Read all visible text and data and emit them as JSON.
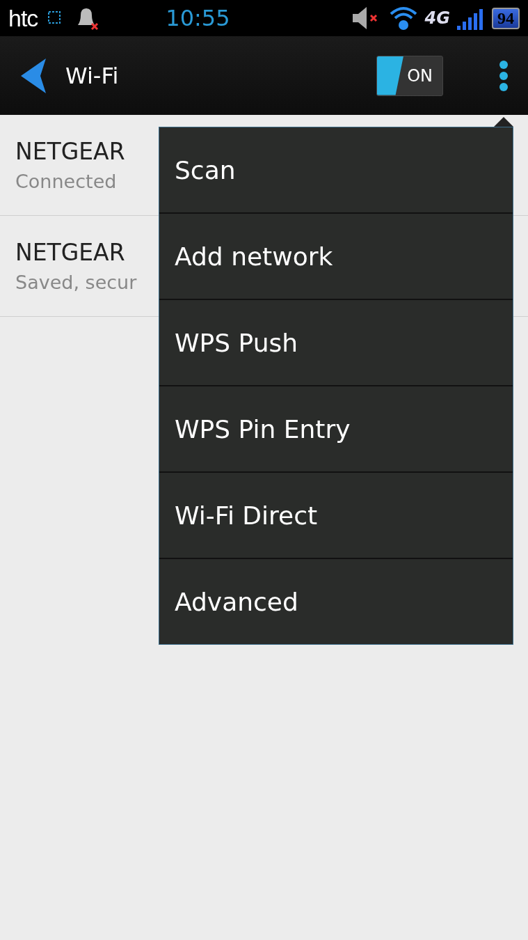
{
  "status_bar": {
    "brand": "htc",
    "time": "10:55",
    "network_type": "4G",
    "battery": "94",
    "muted": true,
    "alerts_muted": true
  },
  "action_bar": {
    "title": "Wi-Fi",
    "toggle": {
      "label": "ON",
      "on": true
    }
  },
  "networks": [
    {
      "name": "NETGEAR",
      "status": "Connected"
    },
    {
      "name": "NETGEAR",
      "status": "Saved, secur"
    }
  ],
  "overflow_menu": {
    "items": [
      "Scan",
      "Add network",
      "WPS Push",
      "WPS Pin Entry",
      "Wi-Fi Direct",
      "Advanced"
    ]
  }
}
